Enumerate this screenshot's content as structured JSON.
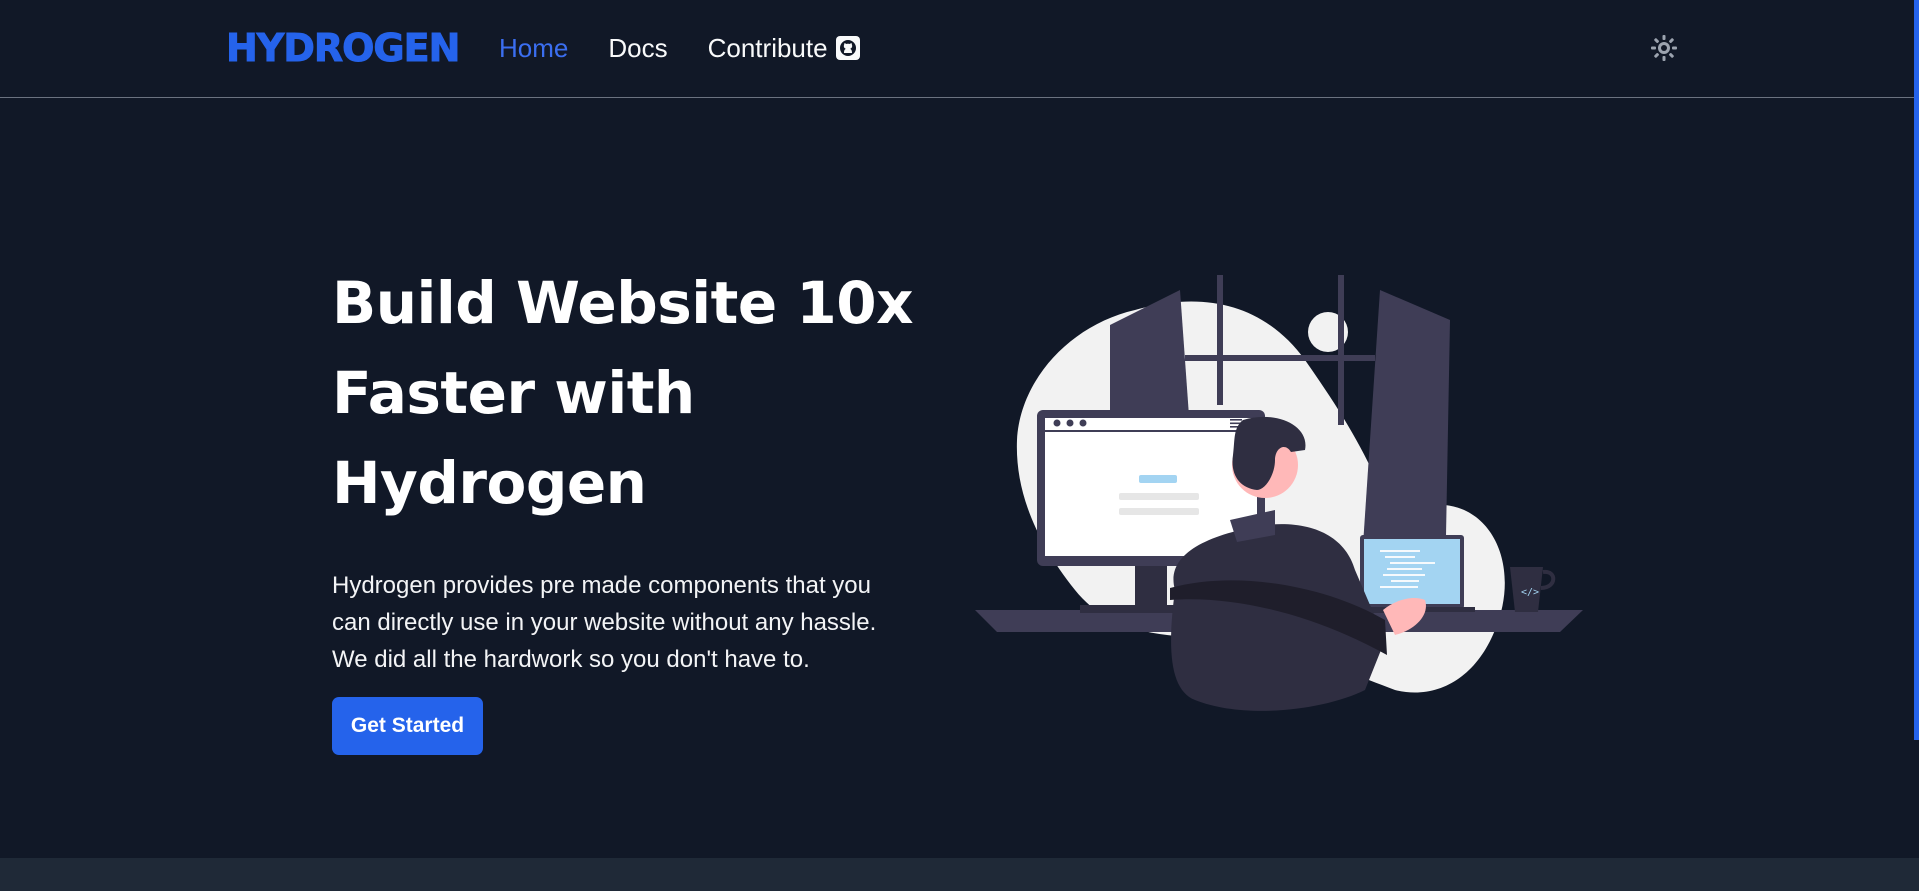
{
  "nav": {
    "logo": "HYDROGEN",
    "links": [
      {
        "label": "Home",
        "active": true
      },
      {
        "label": "Docs",
        "active": false
      },
      {
        "label": "Contribute",
        "active": false
      }
    ],
    "contribute_icon": "github-icon",
    "theme_toggle_icon": "sun-icon"
  },
  "hero": {
    "title_lines": [
      "Build Website 10x",
      "Faster with",
      "Hydrogen"
    ],
    "description_lines": [
      "Hydrogen provides pre made components that you",
      "can directly use in your website without any hassle.",
      "We did all the hardwork so you don't have to."
    ],
    "cta_label": "Get Started",
    "illustration_icon": "developer-at-desk-illustration"
  },
  "colors": {
    "background": "#111827",
    "accent": "#2563eb",
    "footer_strip": "#1f2937"
  }
}
